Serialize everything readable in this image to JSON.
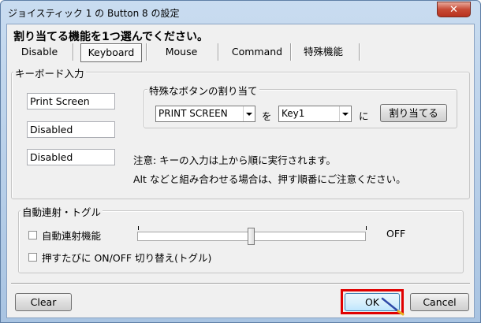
{
  "window": {
    "title": "ジョイスティック 1 の Button 8 の設定",
    "close_glyph": "✕"
  },
  "heading": "割り当てる機能を1つ選んでください。",
  "tabs": [
    {
      "label": "Disable",
      "active": false
    },
    {
      "label": "Keyboard",
      "active": true
    },
    {
      "label": "Mouse",
      "active": false
    },
    {
      "label": "Command",
      "active": false
    },
    {
      "label": "特殊機能",
      "active": false
    }
  ],
  "keyboard_group": {
    "label": "キーボード入力",
    "fields": [
      "Print Screen",
      "Disabled",
      "Disabled"
    ],
    "special_group": {
      "label": "特殊なボタンの割り当て",
      "key_select": "PRINT SCREEN",
      "wo": "を",
      "slot_select": "Key1",
      "ni": "に",
      "assign_button": "割り当てる"
    },
    "note_line1": "注意: キーの入力は上から順に実行されます。",
    "note_line2": "Alt などと組み合わせる場合は、押す順番にご注意ください。"
  },
  "autofire_group": {
    "label": "自動連射・トグル",
    "autofire_label": "自動連射機能",
    "autofire_checked": false,
    "slider_value": 0.5,
    "slider_status": "OFF",
    "toggle_label": "押すたびに ON/OFF 切り替え(トグル)",
    "toggle_checked": false
  },
  "footer": {
    "clear": "Clear",
    "ok": "OK",
    "cancel": "Cancel"
  },
  "colors": {
    "highlight": "#e00000",
    "close_button": "#c74a35"
  }
}
